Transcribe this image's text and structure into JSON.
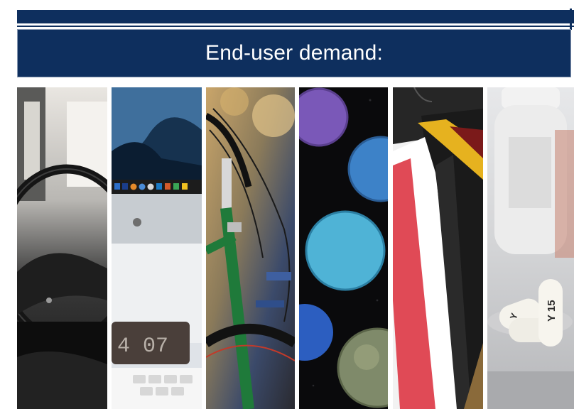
{
  "header": {
    "title": "End-user demand:"
  },
  "colors": {
    "banner": "#0e2f5e",
    "banner_text": "#ffffff",
    "banner_border": "#8a9ab3"
  },
  "panels": [
    {
      "icon": "car-steering-wheel-icon"
    },
    {
      "icon": "computer-monitor-icon"
    },
    {
      "icon": "bicycle-icon"
    },
    {
      "icon": "eyeshadow-palette-icon"
    },
    {
      "icon": "clothing-rack-icon"
    },
    {
      "icon": "medicine-pills-icon"
    }
  ],
  "screen_text": {
    "clock": "4 07",
    "pill_a": "Y 15",
    "pill_b": "Y"
  }
}
